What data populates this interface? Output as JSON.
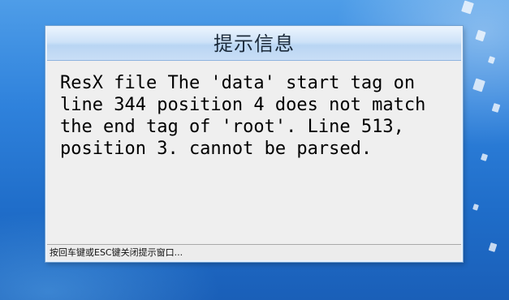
{
  "dialog": {
    "title": "提示信息",
    "message_lines": [
      "ResX file The 'data' start tag on",
      "line 344 position 4 does not match",
      "the end tag of 'root'. Line 513,",
      "position 3. cannot be parsed."
    ],
    "status_hint": "按回车键或ESC键关闭提示窗口..."
  },
  "colors": {
    "desktop_background": "#2f82dc",
    "title_bar": "#cde2f8",
    "dialog_body": "#efefef",
    "text": "#000000"
  }
}
